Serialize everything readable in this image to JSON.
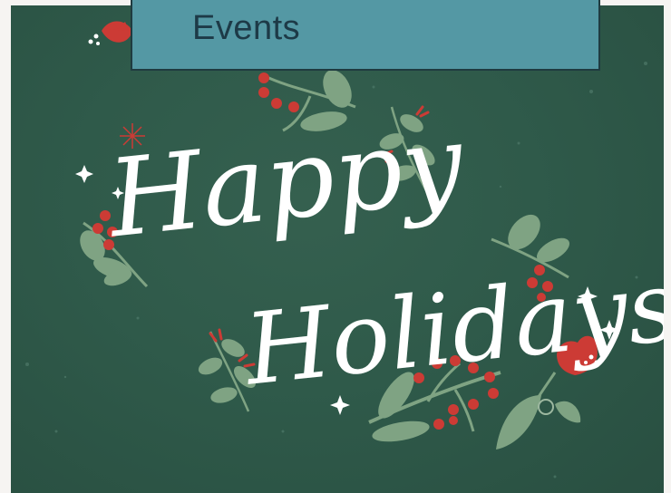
{
  "header": {
    "title": "Events"
  },
  "banner": {
    "greeting_word_1": "Happy",
    "greeting_word_2": "Holidays"
  },
  "colors": {
    "background": "#2f5a4a",
    "title_box": "#5498a4",
    "berry": "#cc3b35",
    "leaf": "#7fa383",
    "lettering": "#ffffff"
  },
  "icons": [
    "sparkle-icon",
    "tulip-icon",
    "berry-branch-icon",
    "leaf-sprig-icon",
    "snowflake-icon"
  ]
}
